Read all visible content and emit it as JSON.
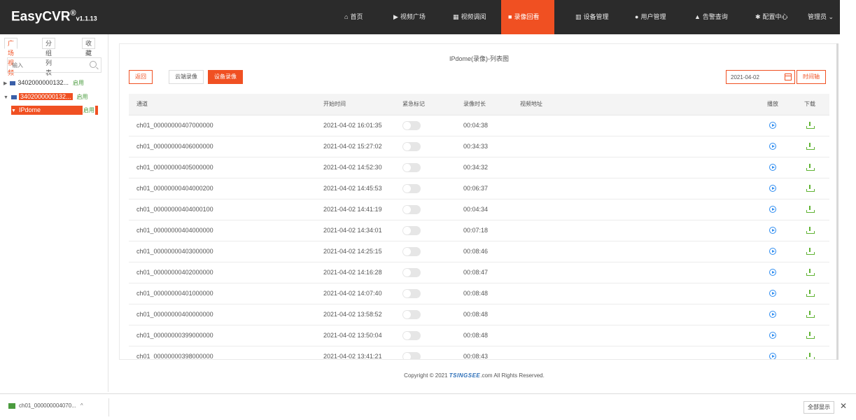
{
  "app": {
    "title": "EasyCVR",
    "reg": "®",
    "version": "v1.1.13"
  },
  "nav": [
    {
      "label": "首页",
      "icon": "home-icon",
      "glyph": "⌂"
    },
    {
      "label": "视频广场",
      "icon": "play-circle-icon",
      "glyph": "▶"
    },
    {
      "label": "视频调阅",
      "icon": "grid-icon",
      "glyph": "▦"
    },
    {
      "label": "录像回看",
      "icon": "video-camera-icon",
      "glyph": "■",
      "active": true
    },
    {
      "label": "设备管理",
      "icon": "device-icon",
      "glyph": "▥"
    },
    {
      "label": "用户管理",
      "icon": "user-icon",
      "glyph": "●"
    },
    {
      "label": "告警查询",
      "icon": "alarm-icon",
      "glyph": "▲"
    },
    {
      "label": "配置中心",
      "icon": "gear-icon",
      "glyph": "✱"
    },
    {
      "label": "管理员 ⌄",
      "icon": "user-menu-icon",
      "glyph": ""
    }
  ],
  "sidebar": {
    "tabs": [
      "广场视频",
      "分组列表",
      "收藏"
    ],
    "search_placeholder": "输入",
    "tree": [
      {
        "label": "3402000000132...",
        "status": "启用"
      },
      {
        "label": "3402000000132...",
        "status": "启用"
      },
      {
        "label": "IPdome",
        "status": "启用"
      }
    ]
  },
  "panel": {
    "title": "IPdome(录像)-列表图",
    "back": "返回",
    "cloud": "云端录像",
    "device": "设备录像",
    "date": "2021-04-02",
    "timeline": "时间轴"
  },
  "table": {
    "headers": [
      "通道",
      "开始时间",
      "紧急标记",
      "录像时长",
      "视频地址",
      "播放",
      "下载"
    ],
    "rows": [
      {
        "name": "ch01_00000000407000000",
        "start": "2021-04-02 16:01:35",
        "duration": "00:04:38"
      },
      {
        "name": "ch01_00000000406000000",
        "start": "2021-04-02 15:27:02",
        "duration": "00:34:33"
      },
      {
        "name": "ch01_00000000405000000",
        "start": "2021-04-02 14:52:30",
        "duration": "00:34:32"
      },
      {
        "name": "ch01_00000000404000200",
        "start": "2021-04-02 14:45:53",
        "duration": "00:06:37"
      },
      {
        "name": "ch01_00000000404000100",
        "start": "2021-04-02 14:41:19",
        "duration": "00:04:34"
      },
      {
        "name": "ch01_00000000404000000",
        "start": "2021-04-02 14:34:01",
        "duration": "00:07:18"
      },
      {
        "name": "ch01_00000000403000000",
        "start": "2021-04-02 14:25:15",
        "duration": "00:08:46"
      },
      {
        "name": "ch01_00000000402000000",
        "start": "2021-04-02 14:16:28",
        "duration": "00:08:47"
      },
      {
        "name": "ch01_00000000401000000",
        "start": "2021-04-02 14:07:40",
        "duration": "00:08:48"
      },
      {
        "name": "ch01_00000000400000000",
        "start": "2021-04-02 13:58:52",
        "duration": "00:08:48"
      },
      {
        "name": "ch01_00000000399000000",
        "start": "2021-04-02 13:50:04",
        "duration": "00:08:48"
      },
      {
        "name": "ch01_00000000398000000",
        "start": "2021-04-02 13:41:21",
        "duration": "00:08:43"
      }
    ]
  },
  "footer": {
    "prefix": "Copyright © 2021 ",
    "brand": "TSINGSEE",
    "suffix": ".com All Rights Reserved."
  },
  "download_bar": {
    "file": "ch01_000000004070...",
    "caret": "^",
    "show_all": "全部显示",
    "close": "✕"
  },
  "colors": {
    "accent": "#f05022",
    "topbar": "#2b2b2b",
    "play": "#2d8cf0",
    "download": "#5fb332",
    "enabled": "#4a9b3e"
  }
}
